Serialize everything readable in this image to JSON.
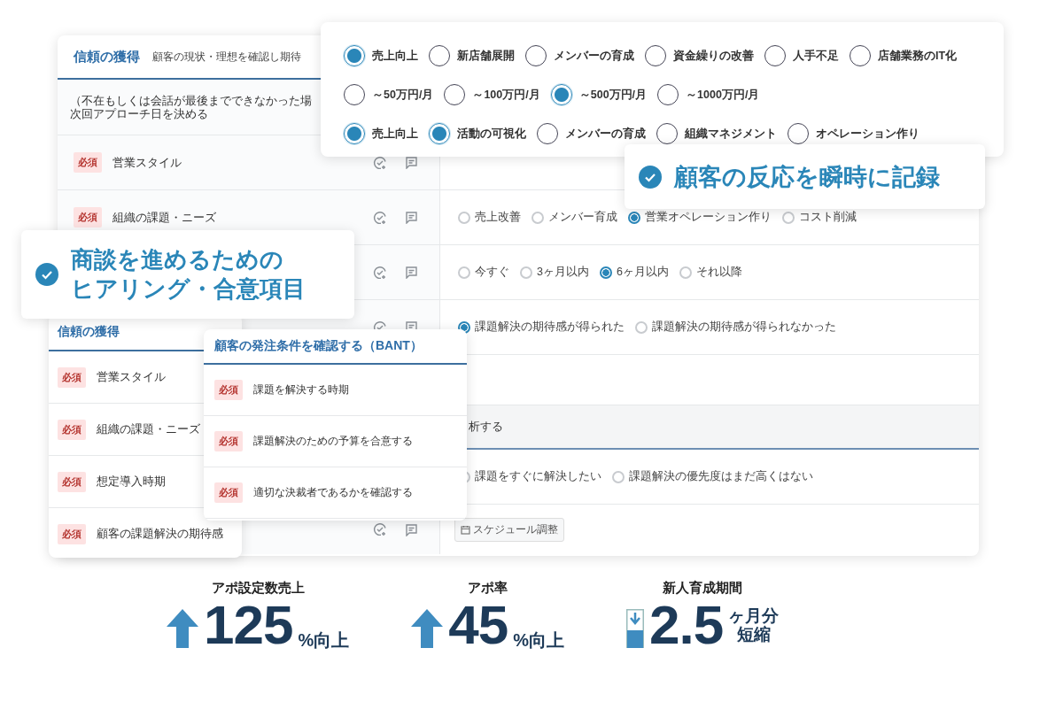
{
  "main_panel": {
    "heading": "信頼の獲得",
    "subheading": "顧客の現状・理想を確認し期待",
    "note_lines": [
      "（不在もしくは会話が最後までできなかった場",
      "次回アプローチ日を決める"
    ],
    "rows": [
      {
        "kind": "item",
        "badge": "必須",
        "label": "営業スタイル",
        "actions": true,
        "options": []
      },
      {
        "kind": "item",
        "badge": "必須",
        "label": "組織の課題・ニーズ",
        "actions": true,
        "options": [
          {
            "label": "売上改善",
            "selected": false
          },
          {
            "label": "メンバー育成",
            "selected": false
          },
          {
            "label": "営業オペレーション作り",
            "selected": true
          },
          {
            "label": "コスト削減",
            "selected": false
          }
        ]
      },
      {
        "kind": "item",
        "actions": true,
        "options": [
          {
            "label": "今すぐ",
            "selected": false
          },
          {
            "label": "3ヶ月以内",
            "selected": false
          },
          {
            "label": "6ヶ月以内",
            "selected": true
          },
          {
            "label": "それ以降",
            "selected": false
          }
        ]
      },
      {
        "kind": "item",
        "actions": true,
        "options": [
          {
            "label": "課題解決の期待感が得られた",
            "selected": true
          },
          {
            "label": "課題解決の期待感が得られなかった",
            "selected": false
          }
        ]
      },
      {
        "kind": "blank"
      },
      {
        "kind": "section",
        "title": "析する"
      },
      {
        "kind": "item",
        "options": [
          {
            "label": "課題をすぐに解決したい",
            "selected": false
          },
          {
            "label": "課題解決の優先度はまだ高くはない",
            "selected": false
          }
        ]
      },
      {
        "kind": "button",
        "actions": true,
        "button": "スケジュール調整"
      }
    ]
  },
  "popup": {
    "rows": [
      {
        "options": [
          {
            "label": "売上向上",
            "selected": true
          },
          {
            "label": "新店舗展開",
            "selected": false
          },
          {
            "label": "メンバーの育成",
            "selected": false
          },
          {
            "label": "資金繰りの改善",
            "selected": false
          },
          {
            "label": "人手不足",
            "selected": false
          },
          {
            "label": "店舗業務のIT化",
            "selected": false
          }
        ]
      },
      {
        "options": [
          {
            "label": "～50万円/月",
            "selected": false
          },
          {
            "label": "～100万円/月",
            "selected": false
          },
          {
            "label": "～500万円/月",
            "selected": true
          },
          {
            "label": "～1000万円/月",
            "selected": false
          }
        ]
      },
      {
        "options": [
          {
            "label": "売上向上",
            "selected": true
          },
          {
            "label": "活動の可視化",
            "selected": true
          },
          {
            "label": "メンバーの育成",
            "selected": false
          },
          {
            "label": "組織マネジメント",
            "selected": false
          },
          {
            "label": "オペレーション作り",
            "selected": false
          }
        ]
      }
    ]
  },
  "callout_right": {
    "lines": [
      "顧客の反応を瞬時に記録"
    ]
  },
  "callout_left": {
    "lines": [
      "商談を進めるための",
      "ヒアリング・合意項目"
    ]
  },
  "side_panel": {
    "heading": "信頼の獲得",
    "items": [
      {
        "badge": "必須",
        "label": "営業スタイル"
      },
      {
        "badge": "必須",
        "label": "組織の課題・ニーズ"
      },
      {
        "badge": "必須",
        "label": "想定導入時期"
      },
      {
        "badge": "必須",
        "label": "顧客の課題解決の期待感"
      }
    ]
  },
  "bant_panel": {
    "heading": "顧客の発注条件を確認する（BANT）",
    "items": [
      {
        "badge": "必須",
        "label": "課題を解決する時期"
      },
      {
        "badge": "必須",
        "label": "課題解決のための予算を合意する"
      },
      {
        "badge": "必須",
        "label": "適切な決裁者であるかを確認する"
      }
    ]
  },
  "stats": [
    {
      "label": "アポ設定数売上",
      "value": "125",
      "unit": [
        "%向上"
      ],
      "kind": "up"
    },
    {
      "label": "アポ率",
      "value": "45",
      "unit": [
        "%向上"
      ],
      "kind": "up"
    },
    {
      "label": "新人育成期間",
      "value": "2.5",
      "unit": [
        "ヶ月分",
        "短縮"
      ],
      "kind": "down"
    }
  ]
}
